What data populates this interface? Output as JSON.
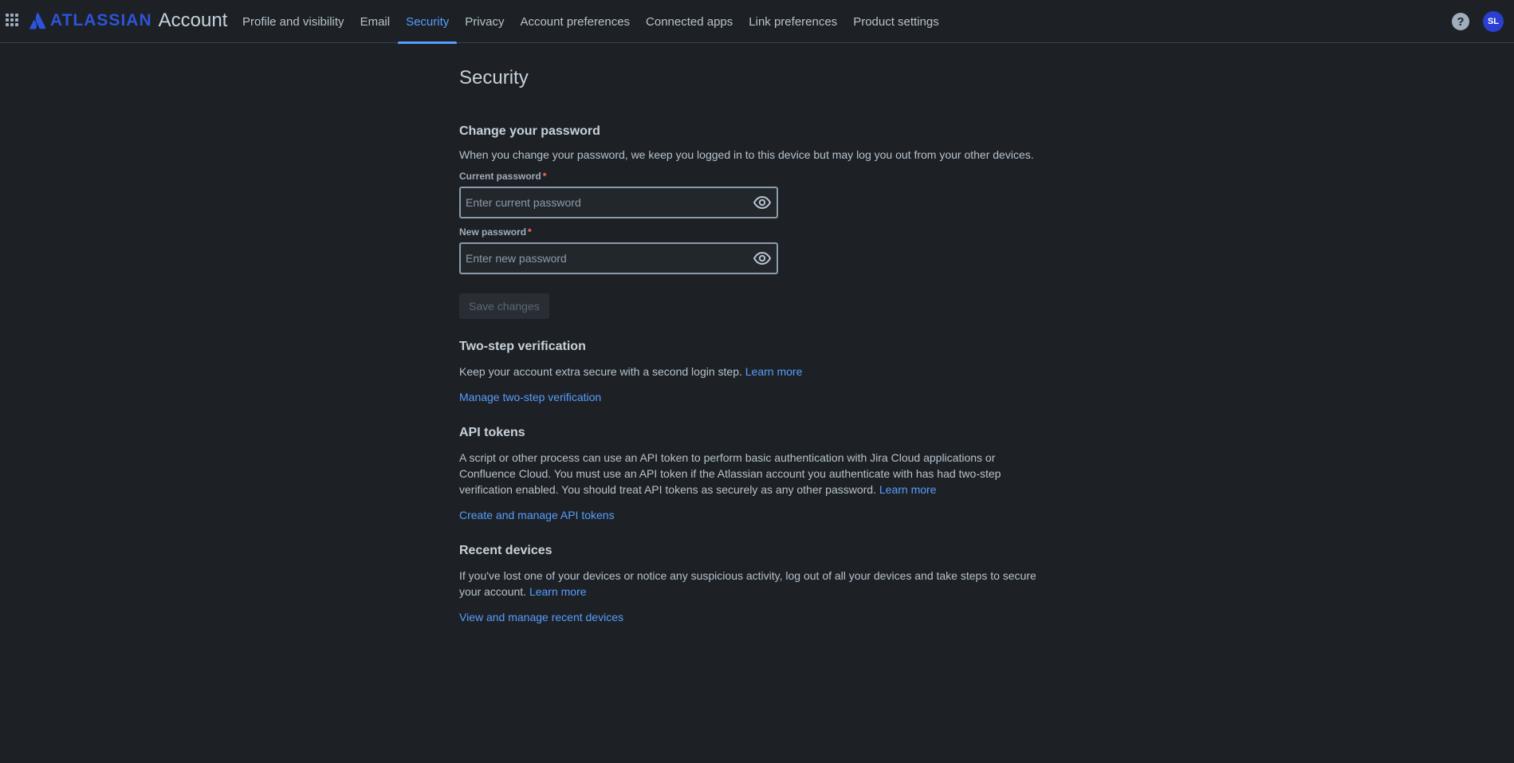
{
  "header": {
    "logo_word": "ATLASSIAN",
    "logo_product": "Account",
    "tabs": [
      {
        "label": "Profile and visibility"
      },
      {
        "label": "Email"
      },
      {
        "label": "Security",
        "active": true
      },
      {
        "label": "Privacy"
      },
      {
        "label": "Account preferences"
      },
      {
        "label": "Connected apps"
      },
      {
        "label": "Link preferences"
      },
      {
        "label": "Product settings"
      }
    ],
    "help_symbol": "?",
    "avatar_initials": "SL",
    "accent_color": "#579dff",
    "brand_color": "#2d53d9"
  },
  "page": {
    "title": "Security"
  },
  "password": {
    "title": "Change your password",
    "description": "When you change your password, we keep you logged in to this device but may log you out from your other devices.",
    "current_label": "Current password",
    "current_placeholder": "Enter current password",
    "current_value": "",
    "new_label": "New password",
    "new_placeholder": "Enter new password",
    "new_value": "",
    "required_mark": "*",
    "save_label": "Save changes"
  },
  "two_step": {
    "title": "Two-step verification",
    "description": "Keep your account extra secure with a second login step.",
    "learn_more": "Learn more",
    "manage_link": "Manage two-step verification"
  },
  "api_tokens": {
    "title": "API tokens",
    "description": "A script or other process can use an API token to perform basic authentication with Jira Cloud applications or Confluence Cloud. You must use an API token if the Atlassian account you authenticate with has had two-step verification enabled. You should treat API tokens as securely as any other password.",
    "learn_more": "Learn more",
    "manage_link": "Create and manage API tokens"
  },
  "recent_devices": {
    "title": "Recent devices",
    "description": "If you've lost one of your devices or notice any suspicious activity, log out of all your devices and take steps to secure your account.",
    "learn_more": "Learn more",
    "manage_link": "View and manage recent devices"
  }
}
